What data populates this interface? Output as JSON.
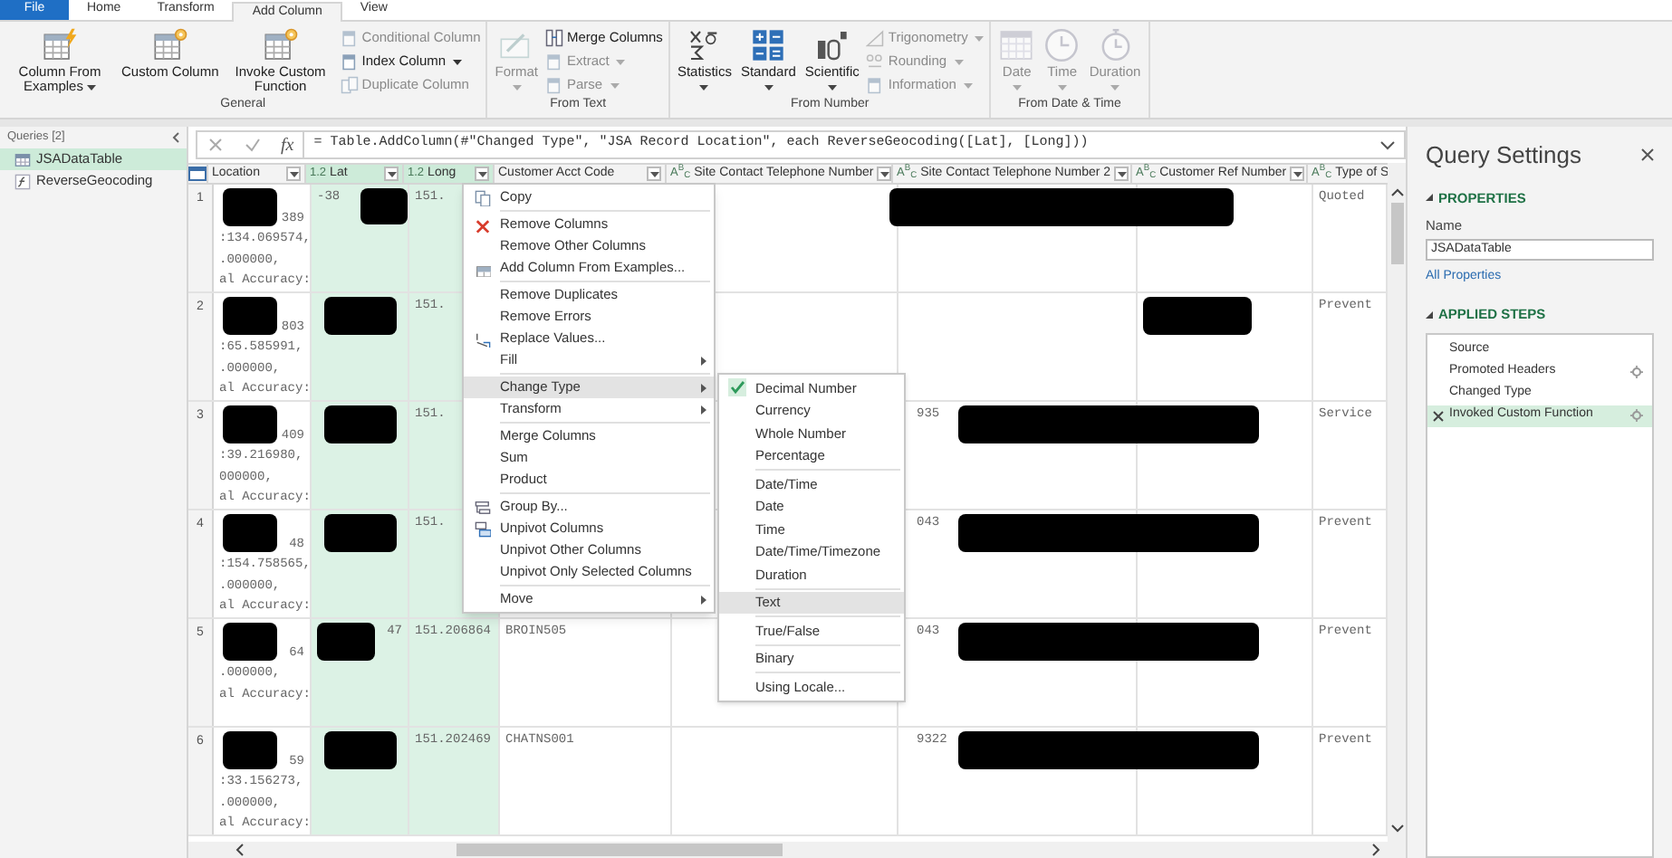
{
  "ribbon_tabs": [
    {
      "label": "File",
      "kind": "file",
      "selected": false
    },
    {
      "label": "Home",
      "kind": "tab",
      "selected": false
    },
    {
      "label": "Transform",
      "kind": "tab",
      "selected": false
    },
    {
      "label": "Add Column",
      "kind": "tab",
      "selected": true
    },
    {
      "label": "View",
      "kind": "tab",
      "selected": false
    }
  ],
  "ribbon_groups": [
    {
      "label": "General",
      "large": [
        {
          "label": "Column From Examples",
          "dropdown": true,
          "disabled": false
        },
        {
          "label": "Custom Column",
          "dropdown": false,
          "disabled": false
        },
        {
          "label": "Invoke Custom Function",
          "dropdown": false,
          "disabled": false
        }
      ],
      "small": [
        {
          "label": "Conditional Column",
          "dropdown": false,
          "disabled": true
        },
        {
          "label": "Index Column",
          "dropdown": true,
          "disabled": false
        },
        {
          "label": "Duplicate Column",
          "dropdown": false,
          "disabled": true
        }
      ]
    },
    {
      "label": "From Text",
      "large": [
        {
          "label": "Format",
          "dropdown": true,
          "disabled": true
        }
      ],
      "small": [
        {
          "label": "Merge Columns",
          "dropdown": false,
          "disabled": false
        },
        {
          "label": "Extract",
          "dropdown": true,
          "disabled": true
        },
        {
          "label": "Parse",
          "dropdown": true,
          "disabled": true
        }
      ]
    },
    {
      "label": "From Number",
      "large": [
        {
          "label": "Statistics",
          "dropdown": true,
          "disabled": false
        },
        {
          "label": "Standard",
          "dropdown": true,
          "disabled": false
        },
        {
          "label": "Scientific",
          "dropdown": true,
          "disabled": false
        }
      ],
      "small": [
        {
          "label": "Trigonometry",
          "dropdown": true,
          "disabled": true
        },
        {
          "label": "Rounding",
          "dropdown": true,
          "disabled": true
        },
        {
          "label": "Information",
          "dropdown": true,
          "disabled": true
        }
      ]
    },
    {
      "label": "From Date & Time",
      "large": [
        {
          "label": "Date",
          "dropdown": true,
          "disabled": true
        },
        {
          "label": "Time",
          "dropdown": true,
          "disabled": true
        },
        {
          "label": "Duration",
          "dropdown": true,
          "disabled": true
        }
      ]
    }
  ],
  "queries": {
    "header": "Queries [2]",
    "items": [
      {
        "label": "JSADataTable",
        "selected": true
      },
      {
        "label": "ReverseGeocoding",
        "selected": false
      }
    ]
  },
  "formula_bar": {
    "fx": "fx",
    "formula": "= Table.AddColumn(#\"Changed Type\", \"JSA Record Location\", each ReverseGeocoding([Lat], [Long]))"
  },
  "table": {
    "columns": [
      {
        "label": "Location",
        "selected": false
      },
      {
        "label": "Lat",
        "type": "1.2",
        "selected": true
      },
      {
        "label": "Long",
        "type": "1.2",
        "selected": true
      },
      {
        "label": "Customer Acct Code",
        "selected": false
      },
      {
        "label": "Site Contact Telephone Number",
        "type": "A$^{B}$$_{C}$",
        "selected": false
      },
      {
        "label": "Site Contact Telephone Number 2",
        "type": "A$^{B}$$_{C}$",
        "selected": false
      },
      {
        "label": "Customer Ref Number",
        "type": "A$^{B}$$_{C}$",
        "selected": false
      },
      {
        "label": "Type of S",
        "type": "A$^{B}$$_{C}$",
        "selected": false
      }
    ],
    "rows": [
      {
        "number": "1",
        "cells": [
          {
            "redacted": true,
            "visible_end": "389",
            "lines": [
              ":134.069574,",
              ".000000,",
              "al Accuracy:"
            ]
          },
          {
            "redacted": true,
            "visible_start": "-38"
          },
          {
            "lines": [
              "151."
            ]
          },
          {},
          {},
          {
            "redacted": true
          },
          {},
          {
            "lines": [
              "Quoted"
            ]
          }
        ]
      },
      {
        "number": "2",
        "cells": [
          {
            "redacted": true,
            "visible_end": "803",
            "lines": [
              ":65.585991,",
              ".000000,",
              "al Accuracy:"
            ]
          },
          {
            "redacted": true
          },
          {
            "lines": [
              "151."
            ]
          },
          {},
          {},
          {},
          {
            "redacted": true
          },
          {
            "lines": [
              "Prevent"
            ]
          }
        ]
      },
      {
        "number": "3",
        "cells": [
          {
            "redacted": true,
            "visible_end": "409",
            "lines": [
              ":39.216980,",
              "000000,",
              "al Accuracy:"
            ]
          },
          {
            "redacted": true
          },
          {
            "lines": [
              "151."
            ]
          },
          {},
          {},
          {
            "redacted": true,
            "visible_start": "935"
          },
          {},
          {
            "lines": [
              "Service"
            ]
          }
        ]
      },
      {
        "number": "4",
        "cells": [
          {
            "redacted": true,
            "visible_end": "48",
            "lines": [
              ":154.758565,",
              ".000000,",
              "al Accuracy:"
            ]
          },
          {
            "redacted": true
          },
          {
            "lines": [
              "151."
            ]
          },
          {},
          {},
          {
            "redacted": true,
            "visible_start": "043"
          },
          {},
          {
            "lines": [
              "Prevent"
            ]
          }
        ]
      },
      {
        "number": "5",
        "cells": [
          {
            "redacted": true,
            "visible_end": "64",
            "lines": [
              ".000000,",
              "al Accuracy:"
            ]
          },
          {
            "redacted": true,
            "visible_end": "47"
          },
          {
            "lines": [
              "151.206864"
            ]
          },
          {
            "lines": [
              "BROIN505"
            ]
          },
          {},
          {
            "redacted": true,
            "visible_start": "043"
          },
          {},
          {
            "lines": [
              "Prevent"
            ]
          }
        ]
      },
      {
        "number": "6",
        "cells": [
          {
            "redacted": true,
            "visible_end": "59",
            "lines": [
              ":33.156273,",
              ".000000,",
              "al Accuracy:"
            ]
          },
          {
            "redacted": true
          },
          {
            "lines": [
              "151.202469"
            ]
          },
          {
            "lines": [
              "CHATNS001"
            ]
          },
          {},
          {
            "redacted": true,
            "visible_start": "9322"
          },
          {},
          {
            "lines": [
              "Prevent"
            ]
          }
        ]
      }
    ]
  },
  "context_menu": [
    {
      "kind": "item",
      "label": "Copy",
      "submenu": false,
      "highlighted": false
    },
    {
      "kind": "separator"
    },
    {
      "kind": "item",
      "label": "Remove Columns",
      "submenu": false,
      "highlighted": false
    },
    {
      "kind": "item",
      "label": "Remove Other Columns",
      "submenu": false,
      "highlighted": false
    },
    {
      "kind": "item",
      "label": "Add Column From Examples...",
      "submenu": false,
      "highlighted": false
    },
    {
      "kind": "separator"
    },
    {
      "kind": "item",
      "label": "Remove Duplicates",
      "submenu": false,
      "highlighted": false
    },
    {
      "kind": "item",
      "label": "Remove Errors",
      "submenu": false,
      "highlighted": false
    },
    {
      "kind": "item",
      "label": "Replace Values...",
      "submenu": false,
      "highlighted": false
    },
    {
      "kind": "item",
      "label": "Fill",
      "submenu": true,
      "highlighted": false
    },
    {
      "kind": "separator"
    },
    {
      "kind": "item",
      "label": "Change Type",
      "submenu": true,
      "highlighted": true
    },
    {
      "kind": "item",
      "label": "Transform",
      "submenu": true,
      "highlighted": false
    },
    {
      "kind": "separator"
    },
    {
      "kind": "item",
      "label": "Merge Columns",
      "submenu": false,
      "highlighted": false
    },
    {
      "kind": "item",
      "label": "Sum",
      "submenu": false,
      "highlighted": false
    },
    {
      "kind": "item",
      "label": "Product",
      "submenu": false,
      "highlighted": false
    },
    {
      "kind": "separator"
    },
    {
      "kind": "item",
      "label": "Group By...",
      "submenu": false,
      "highlighted": false
    },
    {
      "kind": "item",
      "label": "Unpivot Columns",
      "submenu": false,
      "highlighted": false
    },
    {
      "kind": "item",
      "label": "Unpivot Other Columns",
      "submenu": false,
      "highlighted": false
    },
    {
      "kind": "item",
      "label": "Unpivot Only Selected Columns",
      "submenu": false,
      "highlighted": false
    },
    {
      "kind": "separator"
    },
    {
      "kind": "item",
      "label": "Move",
      "submenu": true,
      "highlighted": false
    }
  ],
  "type_submenu": [
    {
      "kind": "item",
      "label": "Decimal Number",
      "checked": true,
      "highlighted": false
    },
    {
      "kind": "item",
      "label": "Currency",
      "checked": false,
      "highlighted": false
    },
    {
      "kind": "item",
      "label": "Whole Number",
      "checked": false,
      "highlighted": false
    },
    {
      "kind": "item",
      "label": "Percentage",
      "checked": false,
      "highlighted": false
    },
    {
      "kind": "separator"
    },
    {
      "kind": "item",
      "label": "Date/Time",
      "checked": false,
      "highlighted": false
    },
    {
      "kind": "item",
      "label": "Date",
      "checked": false,
      "highlighted": false
    },
    {
      "kind": "item",
      "label": "Time",
      "checked": false,
      "highlighted": false
    },
    {
      "kind": "item",
      "label": "Date/Time/Timezone",
      "checked": false,
      "highlighted": false
    },
    {
      "kind": "item",
      "label": "Duration",
      "checked": false,
      "highlighted": false
    },
    {
      "kind": "separator"
    },
    {
      "kind": "item",
      "label": "Text",
      "checked": false,
      "highlighted": true
    },
    {
      "kind": "separator"
    },
    {
      "kind": "item",
      "label": "True/False",
      "checked": false,
      "highlighted": false
    },
    {
      "kind": "separator"
    },
    {
      "kind": "item",
      "label": "Binary",
      "checked": false,
      "highlighted": false
    },
    {
      "kind": "separator"
    },
    {
      "kind": "item",
      "label": "Using Locale...",
      "checked": false,
      "highlighted": false
    }
  ],
  "query_settings": {
    "title": "Query Settings",
    "properties_heading": "PROPERTIES",
    "name_label": "Name",
    "name_value": "JSADataTable",
    "all_properties_link": "All Properties",
    "steps_heading": "APPLIED STEPS",
    "steps": [
      {
        "label": "Source",
        "settings": false,
        "selected": false
      },
      {
        "label": "Promoted Headers",
        "settings": true,
        "selected": false
      },
      {
        "label": "Changed Type",
        "settings": false,
        "selected": false
      },
      {
        "label": "Invoked Custom Function",
        "settings": true,
        "selected": true
      }
    ]
  }
}
